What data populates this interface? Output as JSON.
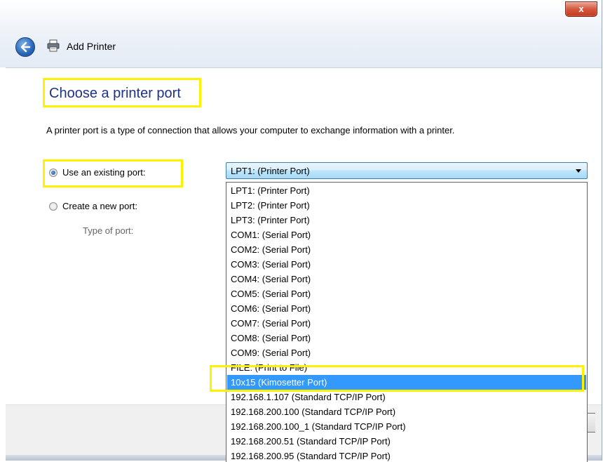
{
  "window": {
    "title": "Add Printer",
    "close_label": "x"
  },
  "page": {
    "heading": "Choose a printer port",
    "description": "A printer port is a type of connection that allows your computer to exchange information with a printer."
  },
  "options": {
    "existing_port_label": "Use an existing port:",
    "new_port_label": "Create a new port:",
    "type_of_port_label": "Type of port:",
    "existing_selected": true
  },
  "port_combo": {
    "value": "LPT1: (Printer Port)"
  },
  "port_list": [
    "LPT1: (Printer Port)",
    "LPT2: (Printer Port)",
    "LPT3: (Printer Port)",
    "COM1: (Serial Port)",
    "COM2: (Serial Port)",
    "COM3: (Serial Port)",
    "COM4: (Serial Port)",
    "COM5: (Serial Port)",
    "COM6: (Serial Port)",
    "COM7: (Serial Port)",
    "COM8: (Serial Port)",
    "COM9: (Serial Port)",
    "FILE: (Print to File)",
    "10x15 (Kimosetter Port)",
    "192.168.1.107 (Standard TCP/IP Port)",
    "192.168.200.100 (Standard TCP/IP Port)",
    "192.168.200.100_1 (Standard TCP/IP Port)",
    "192.168.200.51 (Standard TCP/IP Port)",
    "192.168.200.95 (Standard TCP/IP Port)"
  ],
  "highlighted_item": "10x15 (Kimosetter Port)",
  "colors": {
    "highlight_frame": "#fff200",
    "selection": "#3399ff",
    "heading": "#1e3287"
  },
  "icons": {
    "back": "back-arrow-icon",
    "printer": "printer-icon",
    "close": "close-icon",
    "dropdown": "chevron-down-icon"
  }
}
